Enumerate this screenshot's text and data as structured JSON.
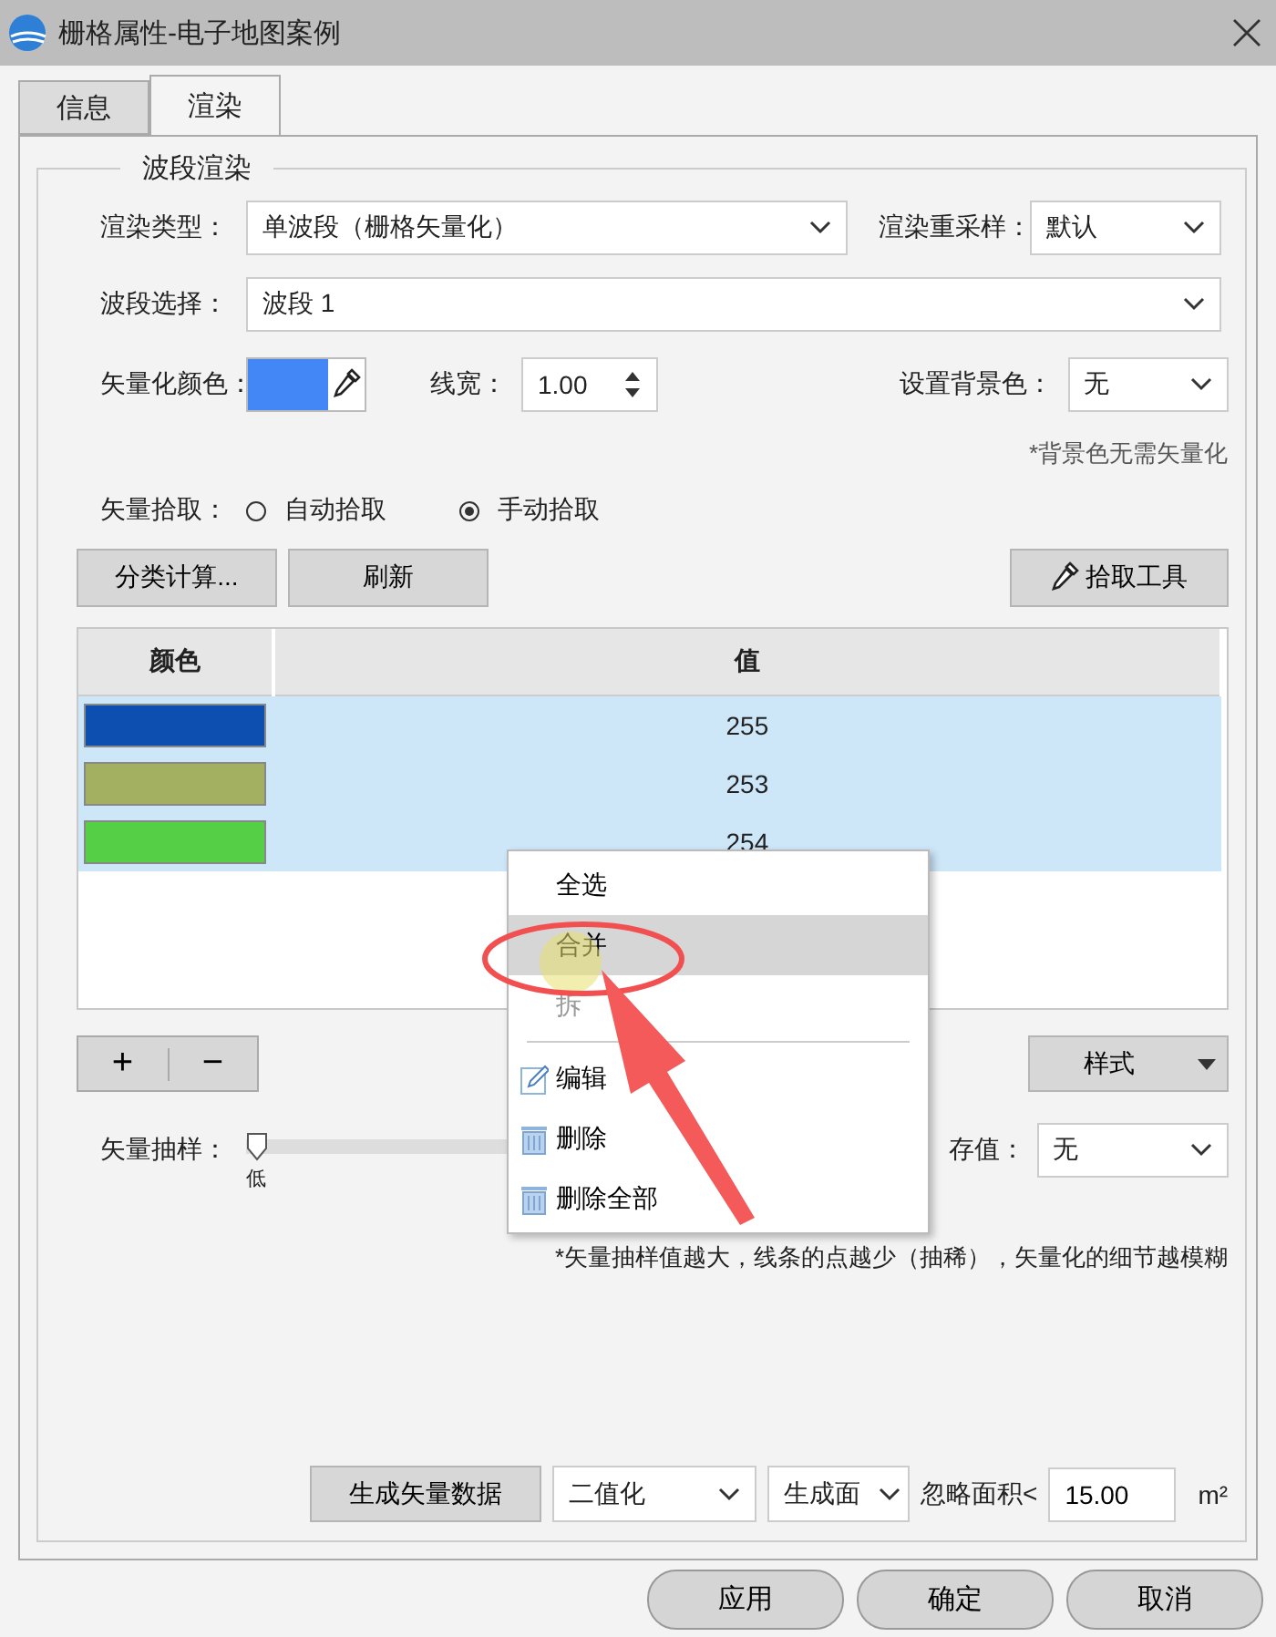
{
  "window": {
    "title": "栅格属性-电子地图案例"
  },
  "tabs": [
    {
      "label": "信息",
      "selected": false
    },
    {
      "label": "渲染",
      "selected": true
    }
  ],
  "group": {
    "title": "波段渲染"
  },
  "render_type": {
    "label": "渲染类型：",
    "value": "单波段（栅格矢量化）"
  },
  "resample": {
    "label": "渲染重采样：",
    "value": "默认"
  },
  "band": {
    "label": "波段选择：",
    "value": "波段 1"
  },
  "vector_color": {
    "label": "矢量化颜色：",
    "color": "#4287f5"
  },
  "line_width": {
    "label": "线宽：",
    "value": "1.00"
  },
  "background": {
    "label": "设置背景色：",
    "value": "无"
  },
  "background_note": "*背景色无需矢量化",
  "pick": {
    "label": "矢量拾取：",
    "options": [
      {
        "label": "自动拾取",
        "selected": false
      },
      {
        "label": "手动拾取",
        "selected": true
      }
    ]
  },
  "actions": [
    "分类计算...",
    "刷新"
  ],
  "pick_tool": "拾取工具",
  "table": {
    "columns": [
      "颜色",
      "值"
    ],
    "rows": [
      {
        "color": "#0c4fb0",
        "value": "255",
        "selected": true
      },
      {
        "color": "#a3b062",
        "value": "253",
        "selected": true
      },
      {
        "color": "#55d046",
        "value": "254",
        "selected": true
      }
    ]
  },
  "add_button": "+",
  "remove_button": "−",
  "style_button": "样式",
  "sampling": {
    "label": "矢量抽样：",
    "level": 0,
    "min_label": "低"
  },
  "nodata": {
    "label": "存值：",
    "value": "无"
  },
  "sampling_note": "*矢量抽样值越大，线条的点越少（抽稀），矢量化的细节越模糊",
  "generate": {
    "button": "生成矢量数据",
    "mode": "二值化",
    "output": "生成面",
    "ignore_label": "忽略面积<",
    "ignore_value": "15.00",
    "unit": "m²"
  },
  "footer_buttons": [
    "应用",
    "确定",
    "取消"
  ],
  "context_menu": {
    "items": [
      {
        "kind": "plain",
        "label": "全选",
        "selected": false,
        "disabled": false
      },
      {
        "kind": "plain",
        "label": "合并",
        "selected": true,
        "disabled": false
      },
      {
        "kind": "plain",
        "label": "拆",
        "selected": false,
        "disabled": true
      },
      {
        "kind": "separator"
      },
      {
        "kind": "edit",
        "label": "编辑",
        "selected": false,
        "disabled": false
      },
      {
        "kind": "delete",
        "label": "删除",
        "selected": false,
        "disabled": false
      },
      {
        "kind": "delete",
        "label": "删除全部",
        "selected": false,
        "disabled": false
      }
    ]
  }
}
